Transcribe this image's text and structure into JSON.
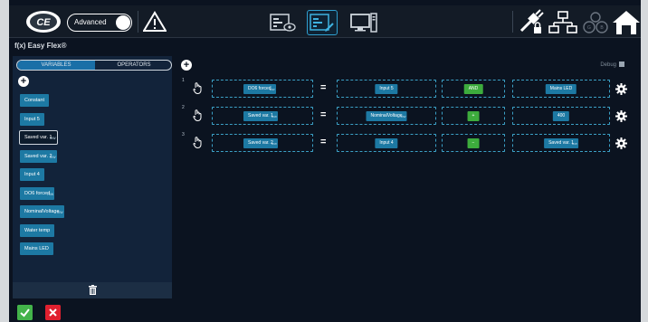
{
  "header": {
    "advanced_label": "Advanced"
  },
  "title": "f(x) Easy Flex®",
  "tabs": [
    {
      "label": "VARIABLES",
      "active": true
    },
    {
      "label": "OPERATORS",
      "active": false
    }
  ],
  "variables": [
    {
      "label": "Constant",
      "badge": ""
    },
    {
      "label": "Input 5",
      "badge": ""
    },
    {
      "label": "Saved var. 1",
      "badge": "R/W",
      "selected": true
    },
    {
      "label": "Saved var. 2",
      "badge": "R/W"
    },
    {
      "label": "Input 4",
      "badge": ""
    },
    {
      "label": "DO6 forced",
      "badge": "R/W"
    },
    {
      "label": "NominalVoltage",
      "badge": "R/W"
    },
    {
      "label": "Water temp",
      "badge": ""
    },
    {
      "label": "Mains LED",
      "badge": ""
    }
  ],
  "debug_label": "Debug",
  "rules": [
    {
      "num": "1",
      "target": "DO6 forced",
      "target_badge": "R/W",
      "left": "Input 5",
      "left_badge": "",
      "op": "AND",
      "right": "Mains LED",
      "right_badge": ""
    },
    {
      "num": "2",
      "target": "Saved var. 1",
      "target_badge": "R/W",
      "left": "NominalVoltage",
      "left_badge": "R/W",
      "op": "+",
      "right": "400",
      "right_badge": ""
    },
    {
      "num": "3",
      "target": "Saved var. 2",
      "target_badge": "R/W",
      "left": "Input 4",
      "left_badge": "",
      "op": "−",
      "right": "Saved var. 1",
      "right_badge": "R/W"
    }
  ],
  "eq_symbol": "=",
  "colors": {
    "accent": "#1d79a3",
    "panel": "#12233a",
    "ok": "#43b34a",
    "cancel": "#e0202f",
    "op_green": "#3dac3d"
  }
}
